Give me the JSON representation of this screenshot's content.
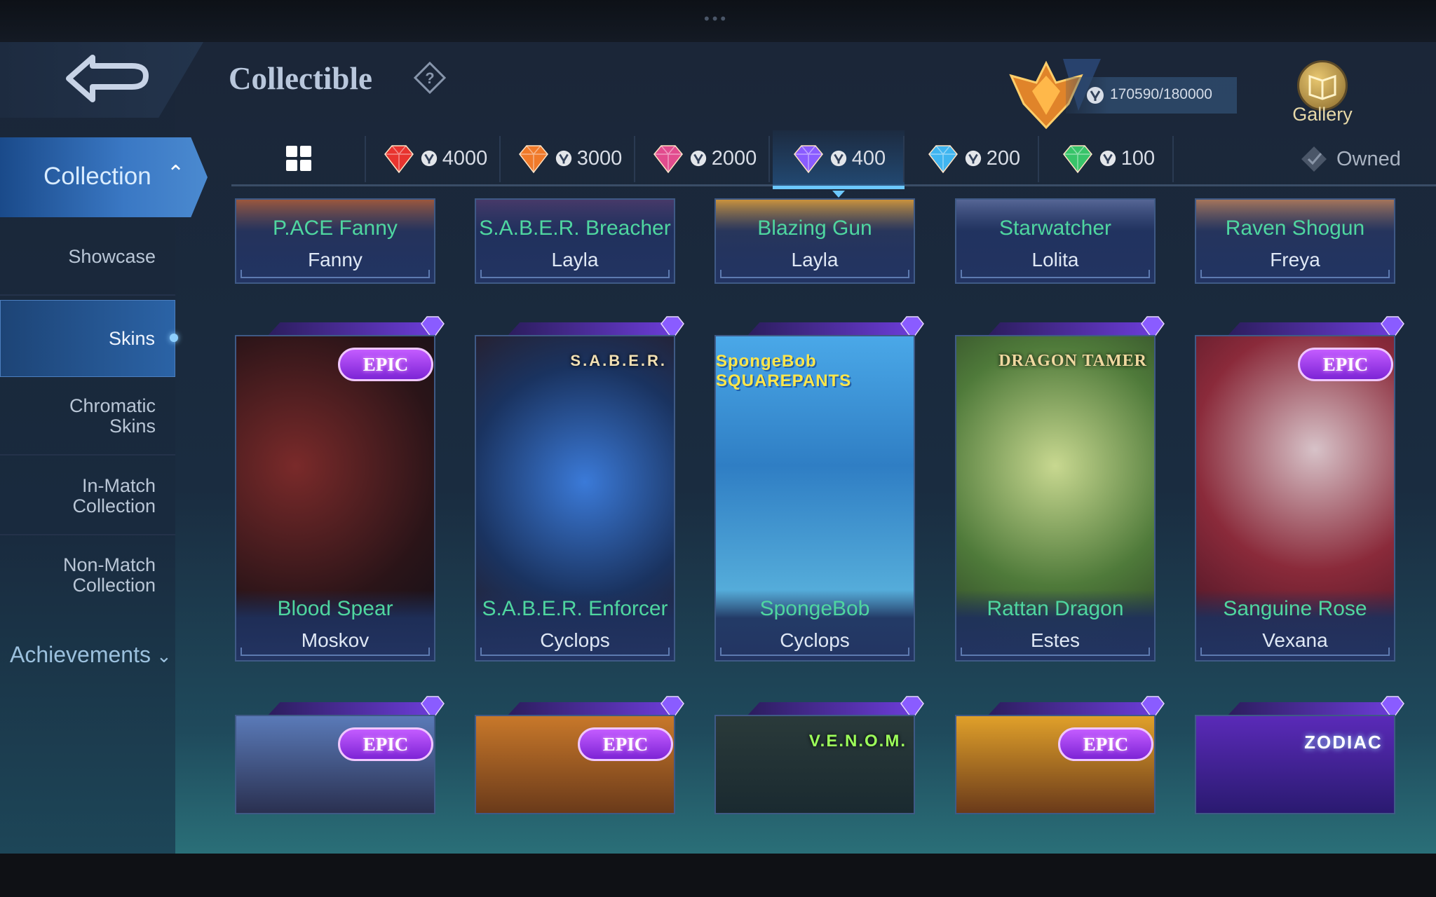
{
  "header": {
    "title": "Collectible",
    "progress": "170590/180000",
    "gallery_label": "Gallery"
  },
  "sidebar": {
    "collection": "Collection",
    "items": [
      {
        "id": "showcase",
        "label": "Showcase"
      },
      {
        "id": "skins",
        "label": "Skins"
      },
      {
        "id": "chromatic-skins",
        "label": "Chromatic Skins"
      },
      {
        "id": "in-match-collection",
        "label": "In-Match Collection"
      },
      {
        "id": "non-match-collection",
        "label": "Non-Match Collection"
      }
    ],
    "active": "Skins",
    "achievements": "Achievements"
  },
  "filters": {
    "tiers": [
      {
        "value": "4000",
        "gem_color": "#e8342f"
      },
      {
        "value": "3000",
        "gem_color": "#f07a2a"
      },
      {
        "value": "2000",
        "gem_color": "#e24c8e"
      },
      {
        "value": "400",
        "gem_color": "#8a5cff"
      },
      {
        "value": "200",
        "gem_color": "#3fb5f0"
      },
      {
        "value": "100",
        "gem_color": "#38c46a"
      }
    ],
    "active_tier": "400",
    "owned_label": "Owned"
  },
  "cards_partial": [
    {
      "skin": "P.ACE Fanny",
      "hero": "Fanny"
    },
    {
      "skin": "S.A.B.E.R. Breacher",
      "hero": "Layla"
    },
    {
      "skin": "Blazing Gun",
      "hero": "Layla"
    },
    {
      "skin": "Starwatcher",
      "hero": "Lolita"
    },
    {
      "skin": "Raven Shogun",
      "hero": "Freya"
    }
  ],
  "cards_full": [
    {
      "skin": "Blood Spear",
      "hero": "Moskov",
      "badge": "EPIC"
    },
    {
      "skin": "S.A.B.E.R. Enforcer",
      "hero": "Cyclops",
      "badge": "S.A.B.E.R."
    },
    {
      "skin": "SpongeBob",
      "hero": "Cyclops",
      "badge": "SpongeBob SQUAREPANTS"
    },
    {
      "skin": "Rattan Dragon",
      "hero": "Estes",
      "badge": "DRAGON TAMER"
    },
    {
      "skin": "Sanguine Rose",
      "hero": "Vexana",
      "badge": "EPIC"
    }
  ],
  "cards_bottom": [
    {
      "badge": "EPIC"
    },
    {
      "badge": "EPIC"
    },
    {
      "badge": "V.E.N.O.M."
    },
    {
      "badge": "EPIC"
    },
    {
      "badge": "ZODIAC"
    }
  ],
  "colors": {
    "skin_name": "#4fd6a0",
    "active_tab": "#3a78c4"
  }
}
